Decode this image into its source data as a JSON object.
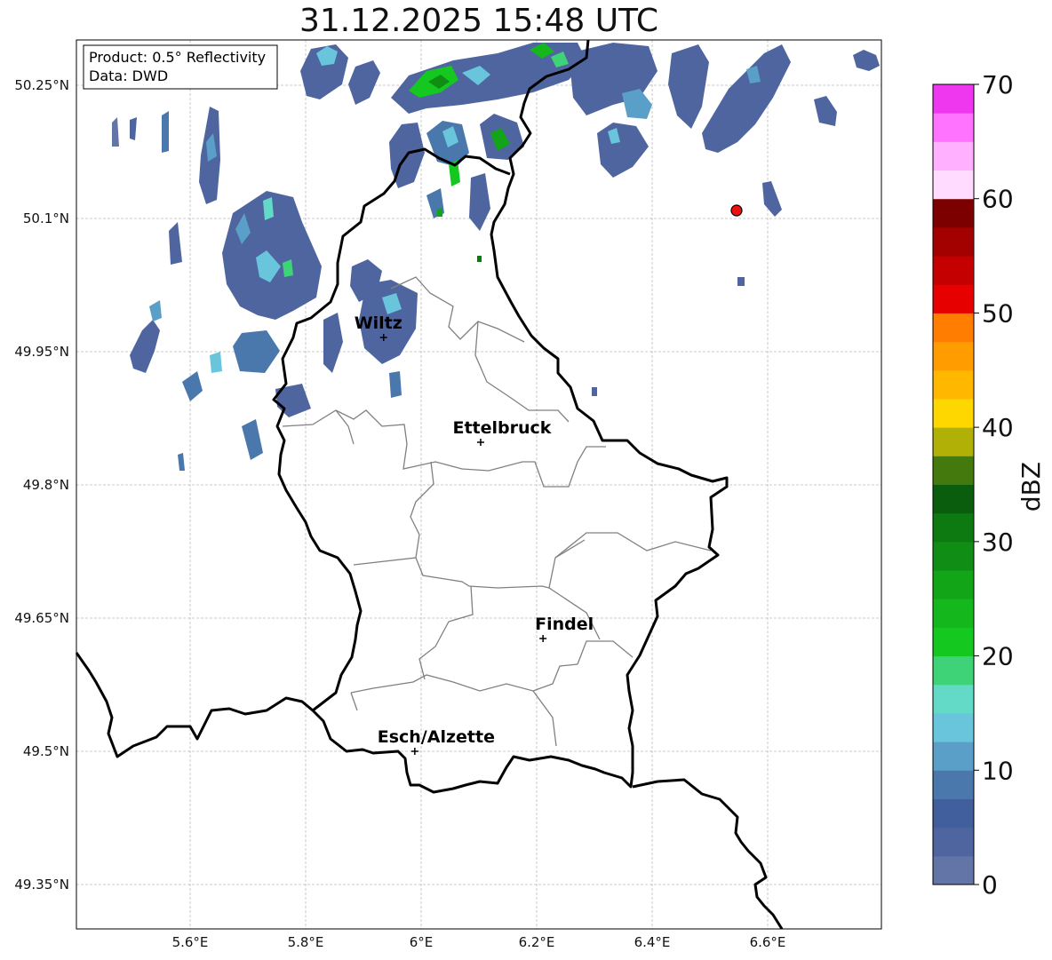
{
  "title": "31.12.2025 15:48 UTC",
  "info_box": {
    "product": "Product: 0.5° Reflectivity",
    "data": "Data: DWD"
  },
  "axes": {
    "lat_ticks": [
      "50.25°N",
      "50.1°N",
      "49.95°N",
      "49.8°N",
      "49.65°N",
      "49.5°N",
      "49.35°N"
    ],
    "lon_ticks": [
      "5.6°E",
      "5.8°E",
      "6°E",
      "6.2°E",
      "6.4°E",
      "6.6°E"
    ]
  },
  "cities": [
    {
      "name": "Wiltz",
      "lon": 5.935,
      "lat": 49.966
    },
    {
      "name": "Ettelbruck",
      "lon": 6.103,
      "lat": 49.848
    },
    {
      "name": "Findel",
      "lon": 6.211,
      "lat": 49.627
    },
    {
      "name": "Esch/Alzette",
      "lon": 5.989,
      "lat": 49.5
    }
  ],
  "radar_site": {
    "lon": 6.548,
    "lat": 50.11,
    "color": "#ee1111"
  },
  "colorbar": {
    "label": "dBZ",
    "ticks": [
      "0",
      "10",
      "20",
      "30",
      "40",
      "50",
      "60",
      "70"
    ],
    "min": 0,
    "max": 70,
    "colors": [
      "#6374a6",
      "#4f659f",
      "#415e9d",
      "#4a78ad",
      "#5a9fc8",
      "#68c5dc",
      "#63dac8",
      "#3fd377",
      "#14c81f",
      "#14b81c",
      "#12a518",
      "#0f8d14",
      "#0c7a11",
      "#0a5d0d",
      "#447a0d",
      "#b0b006",
      "#ffd700",
      "#ffb700",
      "#ff9c00",
      "#ff7d00",
      "#e60000",
      "#c40000",
      "#a30000",
      "#7d0000",
      "#ffdbff",
      "#ffb0ff",
      "#ff73ff",
      "#ee37ee"
    ]
  }
}
